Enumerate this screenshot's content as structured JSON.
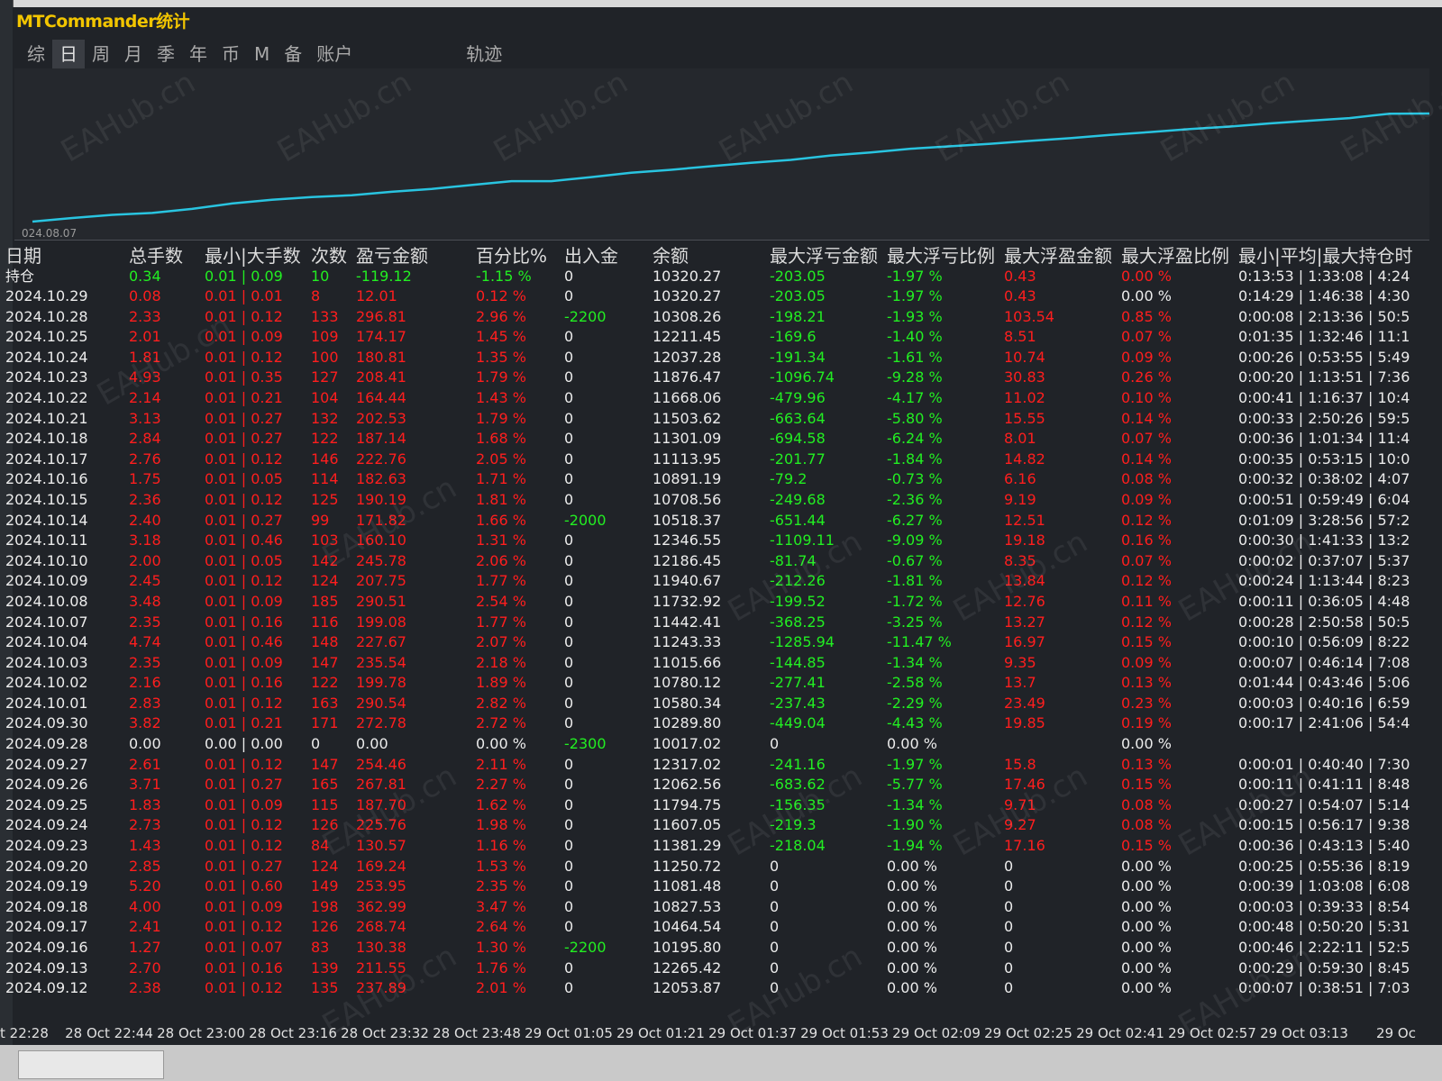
{
  "window": {
    "title": "MTCommander统计"
  },
  "tabs": [
    {
      "label": "综",
      "active": false
    },
    {
      "label": "日",
      "active": true
    },
    {
      "label": "周",
      "active": false
    },
    {
      "label": "月",
      "active": false
    },
    {
      "label": "季",
      "active": false
    },
    {
      "label": "年",
      "active": false
    },
    {
      "label": "币",
      "active": false
    },
    {
      "label": "M",
      "active": false
    },
    {
      "label": "备",
      "active": false
    },
    {
      "label": "账户",
      "active": false
    },
    {
      "label": "轨迹",
      "active": false
    }
  ],
  "chart": {
    "start_date": "024.08.07",
    "line_color": "#29c4e0"
  },
  "table": {
    "headers": [
      "日期",
      "总手数",
      "最小|大手数",
      "次数",
      "盈亏金额",
      "百分比%",
      "出入金",
      "余额",
      "最大浮亏金额",
      "最大浮亏比例",
      "最大浮盈金额",
      "最大浮盈比例",
      "最小|平均|最大持仓时"
    ],
    "summary": {
      "label": "持仓",
      "lots": "0.34",
      "minmax": "0.01 | 0.09",
      "count": "10",
      "pnl": "-119.12",
      "pct": "-1.15 %",
      "io": "0",
      "balance": "10320.27",
      "max_float_loss": "-203.05",
      "max_float_loss_pct": "-1.97 %",
      "max_float_profit": "0.43",
      "max_float_profit_pct": "0.00 %",
      "hold": "0:13:53 | 1:33:08 | 4:24"
    },
    "rows": [
      [
        "2024.10.29",
        "0.08",
        "0.01 | 0.01",
        "8",
        "12.01",
        "0.12 %",
        "0",
        "10320.27",
        "-203.05",
        "-1.97 %",
        "0.43",
        "0.00 %",
        "0:14:29 | 1:46:38 | 4:30"
      ],
      [
        "2024.10.28",
        "2.33",
        "0.01 | 0.12",
        "133",
        "296.81",
        "2.96 %",
        "-2200",
        "10308.26",
        "-198.21",
        "-1.93 %",
        "103.54",
        "0.85 %",
        "0:00:08 | 2:13:36 | 50:5"
      ],
      [
        "2024.10.25",
        "2.01",
        "0.01 | 0.09",
        "109",
        "174.17",
        "1.45 %",
        "0",
        "12211.45",
        "-169.6",
        "-1.40 %",
        "8.51",
        "0.07 %",
        "0:01:35 | 1:32:46 | 11:1"
      ],
      [
        "2024.10.24",
        "1.81",
        "0.01 | 0.12",
        "100",
        "180.81",
        "1.35 %",
        "0",
        "12037.28",
        "-191.34",
        "-1.61 %",
        "10.74",
        "0.09 %",
        "0:00:26 | 0:53:55 | 5:49"
      ],
      [
        "2024.10.23",
        "4.93",
        "0.01 | 0.35",
        "127",
        "208.41",
        "1.79 %",
        "0",
        "11876.47",
        "-1096.74",
        "-9.28 %",
        "30.83",
        "0.26 %",
        "0:00:20 | 1:13:51 | 7:36"
      ],
      [
        "2024.10.22",
        "2.14",
        "0.01 | 0.21",
        "104",
        "164.44",
        "1.43 %",
        "0",
        "11668.06",
        "-479.96",
        "-4.17 %",
        "11.02",
        "0.10 %",
        "0:00:41 | 1:16:37 | 10:4"
      ],
      [
        "2024.10.21",
        "3.13",
        "0.01 | 0.27",
        "132",
        "202.53",
        "1.79 %",
        "0",
        "11503.62",
        "-663.64",
        "-5.80 %",
        "15.55",
        "0.14 %",
        "0:00:33 | 2:50:26 | 59:5"
      ],
      [
        "2024.10.18",
        "2.84",
        "0.01 | 0.27",
        "122",
        "187.14",
        "1.68 %",
        "0",
        "11301.09",
        "-694.58",
        "-6.24 %",
        "8.01",
        "0.07 %",
        "0:00:36 | 1:01:34 | 11:4"
      ],
      [
        "2024.10.17",
        "2.76",
        "0.01 | 0.12",
        "146",
        "222.76",
        "2.05 %",
        "0",
        "11113.95",
        "-201.77",
        "-1.84 %",
        "14.82",
        "0.14 %",
        "0:00:35 | 0:53:15 | 10:0"
      ],
      [
        "2024.10.16",
        "1.75",
        "0.01 | 0.05",
        "114",
        "182.63",
        "1.71 %",
        "0",
        "10891.19",
        "-79.2",
        "-0.73 %",
        "6.16",
        "0.08 %",
        "0:00:32 | 0:38:02 | 4:07"
      ],
      [
        "2024.10.15",
        "2.36",
        "0.01 | 0.12",
        "125",
        "190.19",
        "1.81 %",
        "0",
        "10708.56",
        "-249.68",
        "-2.36 %",
        "9.19",
        "0.09 %",
        "0:00:51 | 0:59:49 | 6:04"
      ],
      [
        "2024.10.14",
        "2.40",
        "0.01 | 0.27",
        "99",
        "171.82",
        "1.66 %",
        "-2000",
        "10518.37",
        "-651.44",
        "-6.27 %",
        "12.51",
        "0.12 %",
        "0:01:09 | 3:28:56 | 57:2"
      ],
      [
        "2024.10.11",
        "3.18",
        "0.01 | 0.46",
        "103",
        "160.10",
        "1.31 %",
        "0",
        "12346.55",
        "-1109.11",
        "-9.09 %",
        "19.18",
        "0.16 %",
        "0:00:30 | 1:41:33 | 13:2"
      ],
      [
        "2024.10.10",
        "2.00",
        "0.01 | 0.05",
        "142",
        "245.78",
        "2.06 %",
        "0",
        "12186.45",
        "-81.74",
        "-0.67 %",
        "8.35",
        "0.07 %",
        "0:00:02 | 0:37:07 | 5:37"
      ],
      [
        "2024.10.09",
        "2.45",
        "0.01 | 0.12",
        "124",
        "207.75",
        "1.77 %",
        "0",
        "11940.67",
        "-212.26",
        "-1.81 %",
        "13.84",
        "0.12 %",
        "0:00:24 | 1:13:44 | 8:23"
      ],
      [
        "2024.10.08",
        "3.48",
        "0.01 | 0.09",
        "185",
        "290.51",
        "2.54 %",
        "0",
        "11732.92",
        "-199.52",
        "-1.72 %",
        "12.76",
        "0.11 %",
        "0:00:11 | 0:36:05 | 4:48"
      ],
      [
        "2024.10.07",
        "2.35",
        "0.01 | 0.16",
        "116",
        "199.08",
        "1.77 %",
        "0",
        "11442.41",
        "-368.25",
        "-3.25 %",
        "13.27",
        "0.12 %",
        "0:00:28 | 2:50:58 | 50:5"
      ],
      [
        "2024.10.04",
        "4.74",
        "0.01 | 0.46",
        "148",
        "227.67",
        "2.07 %",
        "0",
        "11243.33",
        "-1285.94",
        "-11.47 %",
        "16.97",
        "0.15 %",
        "0:00:10 | 0:56:09 | 8:22"
      ],
      [
        "2024.10.03",
        "2.35",
        "0.01 | 0.09",
        "147",
        "235.54",
        "2.18 %",
        "0",
        "11015.66",
        "-144.85",
        "-1.34 %",
        "9.35",
        "0.09 %",
        "0:00:07 | 0:46:14 | 7:08"
      ],
      [
        "2024.10.02",
        "2.16",
        "0.01 | 0.16",
        "122",
        "199.78",
        "1.89 %",
        "0",
        "10780.12",
        "-277.41",
        "-2.58 %",
        "13.7",
        "0.13 %",
        "0:01:44 | 0:43:46 | 5:06"
      ],
      [
        "2024.10.01",
        "2.83",
        "0.01 | 0.12",
        "163",
        "290.54",
        "2.82 %",
        "0",
        "10580.34",
        "-237.43",
        "-2.29 %",
        "23.49",
        "0.23 %",
        "0:00:03 | 0:40:16 | 6:59"
      ],
      [
        "2024.09.30",
        "3.82",
        "0.01 | 0.21",
        "171",
        "272.78",
        "2.72 %",
        "0",
        "10289.80",
        "-449.04",
        "-4.43 %",
        "19.85",
        "0.19 %",
        "0:00:17 | 2:41:06 | 54:4"
      ],
      [
        "2024.09.28",
        "0.00",
        "0.00 | 0.00",
        "0",
        "0.00",
        "0.00 %",
        "-2300",
        "10017.02",
        "0",
        "0.00 %",
        "",
        "0.00 %",
        ""
      ],
      [
        "2024.09.27",
        "2.61",
        "0.01 | 0.12",
        "147",
        "254.46",
        "2.11 %",
        "0",
        "12317.02",
        "-241.16",
        "-1.97 %",
        "15.8",
        "0.13 %",
        "0:00:01 | 0:40:40 | 7:30"
      ],
      [
        "2024.09.26",
        "3.71",
        "0.01 | 0.27",
        "165",
        "267.81",
        "2.27 %",
        "0",
        "12062.56",
        "-683.62",
        "-5.77 %",
        "17.46",
        "0.15 %",
        "0:00:11 | 0:41:11 | 8:48"
      ],
      [
        "2024.09.25",
        "1.83",
        "0.01 | 0.09",
        "115",
        "187.70",
        "1.62 %",
        "0",
        "11794.75",
        "-156.35",
        "-1.34 %",
        "9.71",
        "0.08 %",
        "0:00:27 | 0:54:07 | 5:14"
      ],
      [
        "2024.09.24",
        "2.73",
        "0.01 | 0.12",
        "126",
        "225.76",
        "1.98 %",
        "0",
        "11607.05",
        "-219.3",
        "-1.90 %",
        "9.27",
        "0.08 %",
        "0:00:15 | 0:56:17 | 9:38"
      ],
      [
        "2024.09.23",
        "1.43",
        "0.01 | 0.12",
        "84",
        "130.57",
        "1.16 %",
        "0",
        "11381.29",
        "-218.04",
        "-1.94 %",
        "17.16",
        "0.15 %",
        "0:00:36 | 0:43:13 | 5:40"
      ],
      [
        "2024.09.20",
        "2.85",
        "0.01 | 0.27",
        "124",
        "169.24",
        "1.53 %",
        "0",
        "11250.72",
        "0",
        "0.00 %",
        "0",
        "0.00 %",
        "0:00:25 | 0:55:36 | 8:19"
      ],
      [
        "2024.09.19",
        "5.20",
        "0.01 | 0.60",
        "149",
        "253.95",
        "2.35 %",
        "0",
        "11081.48",
        "0",
        "0.00 %",
        "0",
        "0.00 %",
        "0:00:39 | 1:03:08 | 6:08"
      ],
      [
        "2024.09.18",
        "4.00",
        "0.01 | 0.09",
        "198",
        "362.99",
        "3.47 %",
        "0",
        "10827.53",
        "0",
        "0.00 %",
        "0",
        "0.00 %",
        "0:00:03 | 0:39:33 | 8:54"
      ],
      [
        "2024.09.17",
        "2.41",
        "0.01 | 0.12",
        "126",
        "268.74",
        "2.64 %",
        "0",
        "10464.54",
        "0",
        "0.00 %",
        "0",
        "0.00 %",
        "0:00:48 | 0:50:20 | 5:31"
      ],
      [
        "2024.09.16",
        "1.27",
        "0.01 | 0.07",
        "83",
        "130.38",
        "1.30 %",
        "-2200",
        "10195.80",
        "0",
        "0.00 %",
        "0",
        "0.00 %",
        "0:00:46 | 2:22:11 | 52:5"
      ],
      [
        "2024.09.13",
        "2.70",
        "0.01 | 0.16",
        "139",
        "211.55",
        "1.76 %",
        "0",
        "12265.42",
        "0",
        "0.00 %",
        "0",
        "0.00 %",
        "0:00:29 | 0:59:30 | 8:45"
      ],
      [
        "2024.09.12",
        "2.38",
        "0.01 | 0.12",
        "135",
        "237.89",
        "2.01 %",
        "0",
        "12053.87",
        "0",
        "0.00 %",
        "0",
        "0.00 %",
        "0:00:07 | 0:38:51 | 7:03"
      ]
    ]
  },
  "time_axis": [
    "t 22:28",
    "28 Oct 22:44",
    "28 Oct 23:00",
    "28 Oct 23:16",
    "28 Oct 23:32",
    "28 Oct 23:48",
    "29 Oct 01:05",
    "29 Oct 01:21",
    "29 Oct 01:37",
    "29 Oct 01:53",
    "29 Oct 02:09",
    "29 Oct 02:25",
    "29 Oct 02:41",
    "29 Oct 02:57",
    "29 Oct 03:13",
    "29 Oc"
  ],
  "watermark": "EAHub.cn"
}
